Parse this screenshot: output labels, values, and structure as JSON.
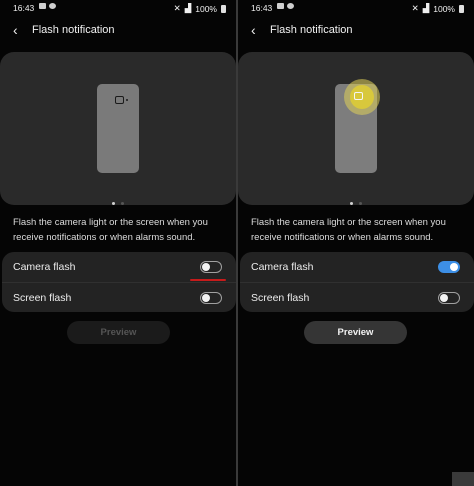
{
  "panels": [
    {
      "status": {
        "time": "16:43",
        "battery": "100%"
      },
      "header": {
        "back_icon": "‹",
        "title": "Flash notification"
      },
      "description": "Flash the camera light or the screen when you receive notifications or when alarms sound.",
      "settings": {
        "camera_flash_label": "Camera flash",
        "camera_flash_on": false,
        "screen_flash_label": "Screen flash",
        "screen_flash_on": false
      },
      "preview_button": {
        "label": "Preview",
        "enabled": false
      }
    },
    {
      "status": {
        "time": "16:43",
        "battery": "100%"
      },
      "header": {
        "back_icon": "‹",
        "title": "Flash notification"
      },
      "description": "Flash the camera light or the screen when you receive notifications or when alarms sound.",
      "settings": {
        "camera_flash_label": "Camera flash",
        "camera_flash_on": true,
        "screen_flash_label": "Screen flash",
        "screen_flash_on": false
      },
      "preview_button": {
        "label": "Preview",
        "enabled": true
      }
    }
  ],
  "colors": {
    "accent": "#3d8fe6",
    "flash_glow": "#d8c83c",
    "annotation_underline": "#c61b1b"
  }
}
